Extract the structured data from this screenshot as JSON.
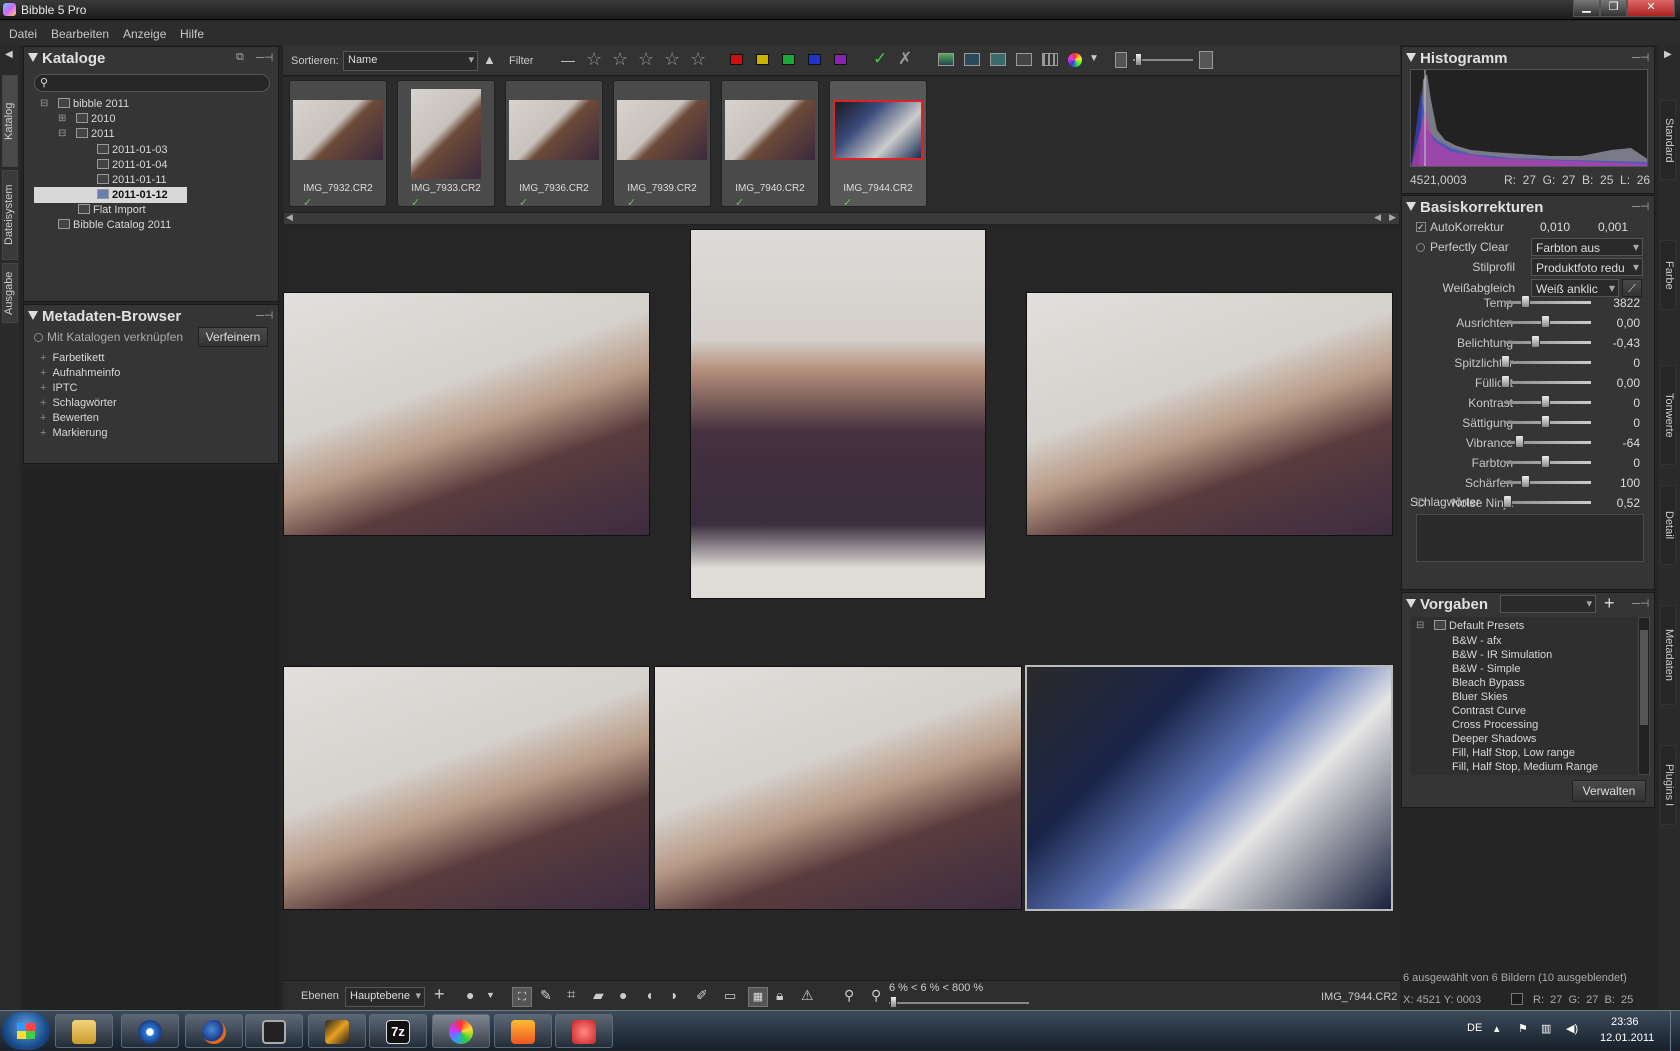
{
  "window": {
    "title": "Bibble 5 Pro",
    "min": "▁",
    "max": "❐",
    "close": "✕"
  },
  "menu": [
    "Datei",
    "Bearbeiten",
    "Anzeige",
    "Hilfe"
  ],
  "left_tabs": [
    "Katalog",
    "Dateisystem",
    "Ausgabe"
  ],
  "right_tabs": [
    "Standard",
    "Farbe",
    "Tonwerte",
    "Detail",
    "Metadaten",
    "Plugins I"
  ],
  "catalogs": {
    "title": "Kataloge",
    "search_placeholder": "",
    "tree": [
      "bibble 2011",
      "2010",
      "2011",
      "2011-01-03",
      "2011-01-04",
      "2011-01-11",
      "2011-01-12",
      "Flat Import",
      "Bibble Catalog 2011"
    ]
  },
  "metadata": {
    "title": "Metadaten-Browser",
    "link_label": "Mit Katalogen verknüpfen",
    "refine": "Verfeinern",
    "items": [
      "Farbetikett",
      "Aufnahmeinfo",
      "IPTC",
      "Schlagwörter",
      "Bewerten",
      "Markierung"
    ]
  },
  "toolbar": {
    "sort_label": "Sortieren:",
    "sort_value": "Name",
    "filter": "Filter",
    "colors": [
      "#cc1111",
      "#c8b400",
      "#1aa83a",
      "#2233cc",
      "#8a22b0"
    ]
  },
  "thumbs": [
    "IMG_7932.CR2",
    "IMG_7933.CR2",
    "IMG_7936.CR2",
    "IMG_7939.CR2",
    "IMG_7940.CR2",
    "IMG_7944.CR2"
  ],
  "status": {
    "layers": "Ebenen",
    "layer_value": "Hauptebene",
    "zoom": "6 % < 6 % < 800 %",
    "filename": "IMG_7944.CR2"
  },
  "histogram": {
    "title": "Histogramm",
    "coords": "4521,0003",
    "rgb": "R:  27  G:  27  B:  25  L:  26"
  },
  "basic": {
    "title": "Basiskorrekturen",
    "auto": "AutoKorrektur",
    "auto_v1": "0,010",
    "auto_v2": "0,001",
    "pc": "Perfectly Clear",
    "pc_value": "Farbton aus",
    "style": "Stilprofil",
    "style_value": "Produktfoto redu",
    "wb": "Weißabgleich",
    "wb_value": "Weiß anklic",
    "sliders": [
      {
        "label": "Temp",
        "value": "3822",
        "pos": 0.25
      },
      {
        "label": "Ausrichten",
        "value": "0,00",
        "pos": 0.5
      },
      {
        "label": "Belichtung",
        "value": "-0,43",
        "pos": 0.38
      },
      {
        "label": "Spitzlichter",
        "value": "0",
        "pos": 0.0
      },
      {
        "label": "Füllicht",
        "value": "0,00",
        "pos": 0.0
      },
      {
        "label": "Kontrast",
        "value": "0",
        "pos": 0.5
      },
      {
        "label": "Sättigung",
        "value": "0",
        "pos": 0.5
      },
      {
        "label": "Vibrance",
        "value": "-64",
        "pos": 0.18
      },
      {
        "label": "Farbton",
        "value": "0",
        "pos": 0.5
      },
      {
        "label": "Schärfen",
        "value": "100",
        "pos": 0.25
      },
      {
        "label": "Noise Ninja",
        "value": "0,52",
        "pos": 0.02
      }
    ],
    "keywords": "Schlagwörter"
  },
  "presets": {
    "title": "Vorgaben",
    "group": "Default Presets",
    "manage": "Verwalten",
    "items": [
      "B&W - afx",
      "B&W - IR Simulation",
      "B&W - Simple",
      "Bleach Bypass",
      "Bluer Skies",
      "Contrast Curve",
      "Cross Processing",
      "Deeper Shadows",
      "Fill, Half Stop, Low range",
      "Fill, Half Stop, Medium Range"
    ]
  },
  "right_status": {
    "selection": "6 ausgewählt von 6 Bildern (10 ausgeblendet)",
    "xy": "X: 4521  Y: 0003",
    "rgb": "R:  27  G:  27  B:  25"
  },
  "taskbar": {
    "lang": "DE",
    "time": "23:36",
    "date": "12.01.2011",
    "zip_label": "7z"
  }
}
